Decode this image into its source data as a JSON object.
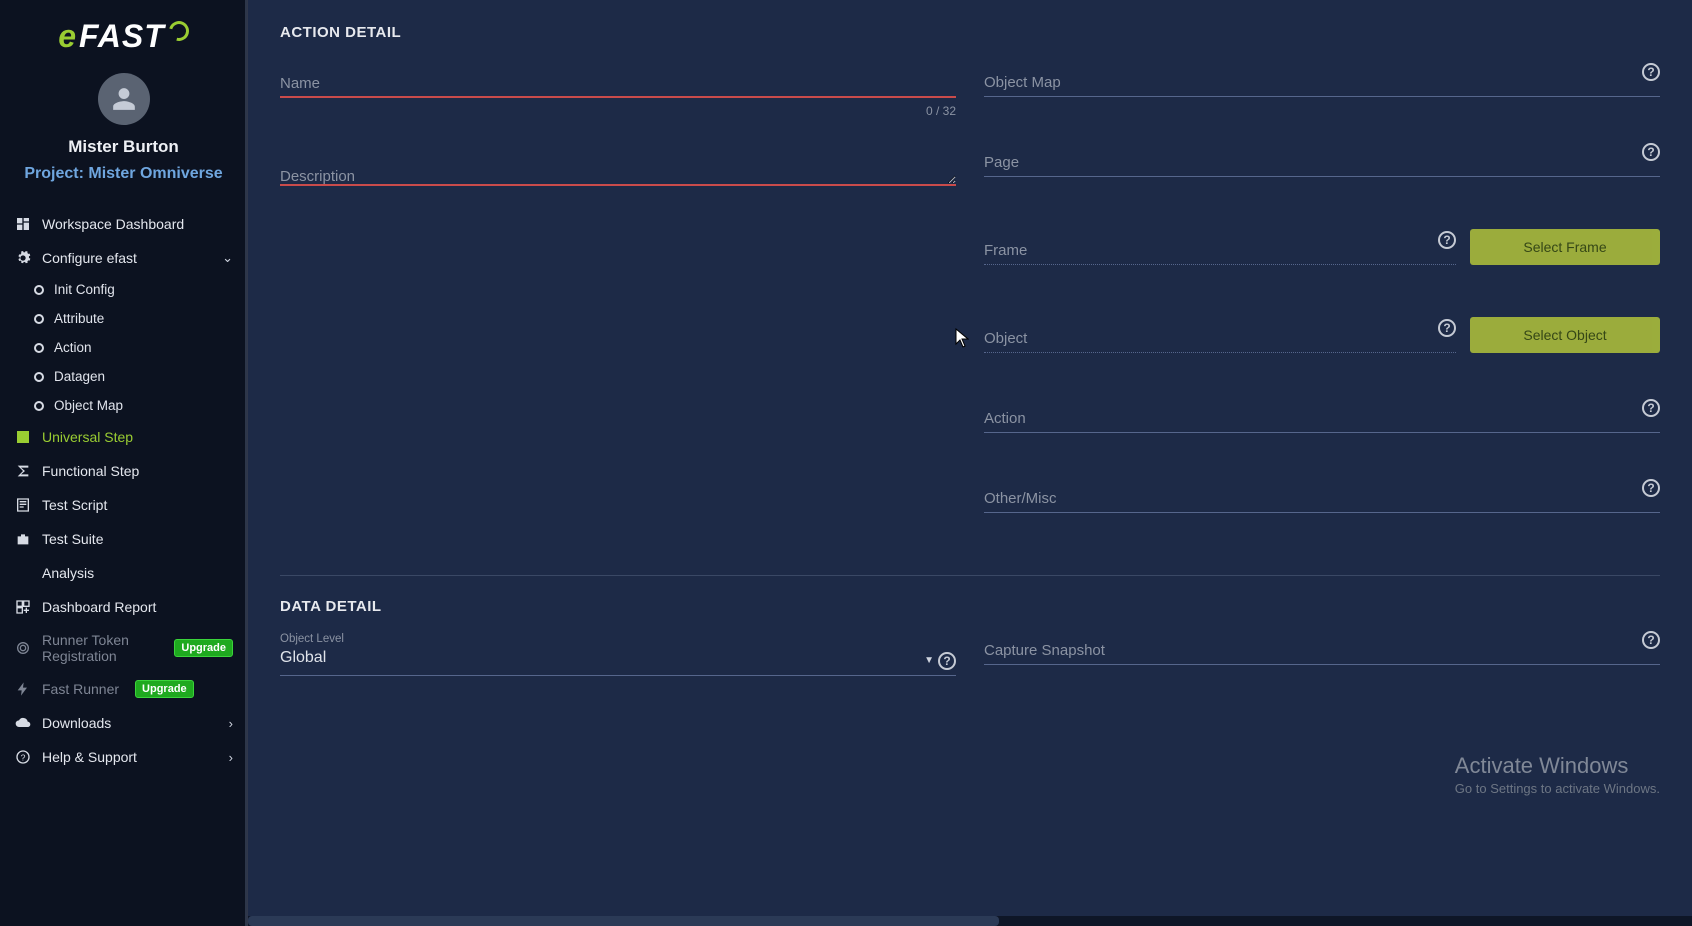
{
  "brand": {
    "e": "e",
    "rest": "FAST"
  },
  "user": {
    "name": "Mister Burton",
    "project_prefix": "Project:",
    "project_name": "Mister Omniverse"
  },
  "sidebar": {
    "items": [
      {
        "label": "Workspace Dashboard"
      },
      {
        "label": "Configure efast"
      },
      {
        "label": "Universal Step"
      },
      {
        "label": "Functional Step"
      },
      {
        "label": "Test Script"
      },
      {
        "label": "Test Suite"
      },
      {
        "label": "Analysis"
      },
      {
        "label": "Dashboard Report"
      },
      {
        "label": "Runner Token Registration"
      },
      {
        "label": "Fast Runner"
      },
      {
        "label": "Downloads"
      },
      {
        "label": "Help & Support"
      }
    ],
    "configure_children": [
      {
        "label": "Init Config"
      },
      {
        "label": "Attribute"
      },
      {
        "label": "Action"
      },
      {
        "label": "Datagen"
      },
      {
        "label": "Object Map"
      }
    ],
    "upgrade_label": "Upgrade"
  },
  "section": {
    "action_detail": "ACTION DETAIL",
    "data_detail": "DATA DETAIL"
  },
  "fields": {
    "name": {
      "label": "Name",
      "counter": "0 / 32"
    },
    "description": {
      "label": "Description"
    },
    "object_map": {
      "label": "Object Map"
    },
    "page": {
      "label": "Page"
    },
    "frame": {
      "label": "Frame",
      "button": "Select Frame"
    },
    "object": {
      "label": "Object",
      "button": "Select Object"
    },
    "action": {
      "label": "Action"
    },
    "other": {
      "label": "Other/Misc"
    },
    "object_level": {
      "mini": "Object Level",
      "value": "Global"
    },
    "capture": {
      "label": "Capture Snapshot"
    }
  },
  "watermark": {
    "line1": "Activate Windows",
    "line2": "Go to Settings to activate Windows."
  }
}
